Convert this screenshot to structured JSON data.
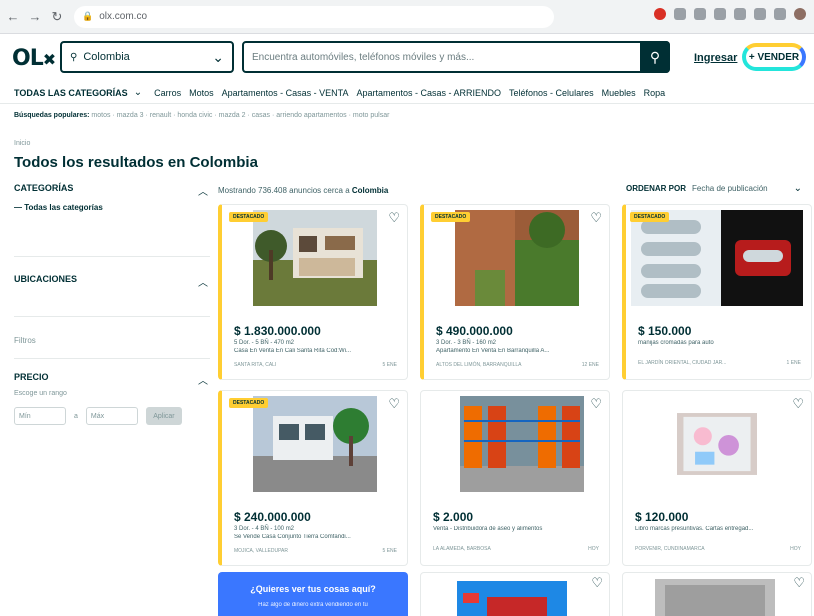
{
  "browser": {
    "url": "olx.com.co"
  },
  "header": {
    "location": "Colombia",
    "search_placeholder": "Encuentra automóviles, teléfonos móviles y más...",
    "login": "Ingresar",
    "sell": "+ VENDER"
  },
  "categories": {
    "all": "TODAS LAS CATEGORÍAS",
    "items": [
      "Carros",
      "Motos",
      "Apartamentos - Casas - VENTA",
      "Apartamentos - Casas - ARRIENDO",
      "Teléfonos - Celulares",
      "Muebles",
      "Ropa"
    ]
  },
  "popular": {
    "label": "Búsquedas populares:",
    "text": "motos · mazda 3 · renault · honda civic · mazda 2 · casas · arriendo apartamentos · moto pulsar"
  },
  "breadcrumb": "Inicio",
  "page_title": "Todos los resultados en Colombia",
  "sidebar": {
    "categories_title": "CATEGORÍAS",
    "all_categories": "Todas las categorías",
    "locations_title": "UBICACIONES",
    "filters": "Filtros",
    "price_title": "PRECIO",
    "price_hint": "Escoge un rango",
    "min": "Mín",
    "max": "Máx",
    "to": "a",
    "apply": "Aplicar"
  },
  "results": {
    "prefix": "Mostrando 736.408 anuncios cerca a",
    "place": "Colombia",
    "sort_label": "ORDENAR POR",
    "sort_value": "Fecha de publicación"
  },
  "cards": [
    {
      "badge": "DESTACADO",
      "price": "$ 1.830.000.000",
      "specs": "5 Dor. - 5 BÑ - 470 m2",
      "desc": "Casa En Venta En Cali Santa Rita Cod:Wi...",
      "place": "SANTA RITA, CALI",
      "date": "5 ENE"
    },
    {
      "badge": "DESTACADO",
      "price": "$ 490.000.000",
      "specs": "3 Dor. - 3 BÑ - 160 m2",
      "desc": "Apartamento En Venta En Barranquilla A...",
      "place": "ALTOS DEL LIMÓN, BARRANQUILLA",
      "date": "12 ENE"
    },
    {
      "badge": "DESTACADO",
      "price": "$ 150.000",
      "specs": "",
      "desc": "manijas cromadas para auto",
      "place": "EL JARDÍN ORIENTAL, CIUDAD JAR...",
      "date": "1 ENE"
    },
    {
      "badge": "DESTACADO",
      "price": "$ 240.000.000",
      "specs": "3 Dor. - 4 BÑ - 100 m2",
      "desc": "Se Vende Casa Conjunto Tierra Comfandi...",
      "place": "MOJICA, VALLEDUPAR",
      "date": "5 ENE"
    },
    {
      "badge": "",
      "price": "$ 2.000",
      "specs": "",
      "desc": "Venta - Distribuidora de aseo y alimentos",
      "place": "LA ALAMEDA, BARBOSA",
      "date": "HOY"
    },
    {
      "badge": "",
      "price": "$ 120.000",
      "specs": "",
      "desc": "Libro marcas presuntivas. Cartas entregad...",
      "place": "PORVENIR, CUNDINAMARCA",
      "date": "HOY"
    }
  ],
  "promo": {
    "title": "¿Quieres ver tus cosas aquí?",
    "text": "Haz algo de dinero extra vendiendo en tu"
  }
}
